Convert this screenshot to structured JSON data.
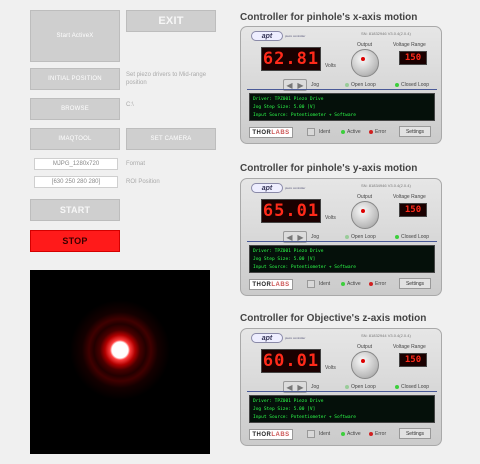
{
  "left": {
    "start_activex": "Start ActiveX",
    "exit": "EXIT",
    "initial_position": "INITIAL POSITION",
    "initial_position_note": "Set piezo drivers to Mid-range position",
    "browse": "BROWSE",
    "browse_path": "C:\\",
    "imaqtool": "IMAQTOOL",
    "set_camera": "SET CAMERA",
    "format_value": "MJPG_1280x720",
    "format_label": "Format",
    "roi_value": "[630 250 280 280]",
    "roi_label": "ROI Position",
    "start": "START",
    "stop": "STOP"
  },
  "controllers": [
    {
      "title": "Controller for pinhole's x-axis motion",
      "apt": "apt",
      "apt_sub": "piezo controller",
      "sn": "SN: 81832946  V3.0.4(2.0.4)",
      "display": "62.81",
      "volts": "Volts",
      "output_label": "Output",
      "vr_label": "Voltage Range",
      "vr": "150",
      "jog": "Jog",
      "open_loop": "Open Loop",
      "closed_loop": "Closed Loop",
      "status": [
        "Driver: TPZ001 Piezo Drive",
        "Jog Step Size: 5.00 [V]",
        "Input Source: Potentiometer + Software"
      ],
      "thorlabs": [
        "THOR",
        "LABS"
      ],
      "ident": "Ident",
      "active": "Active",
      "error": "Error",
      "settings": "Settings"
    },
    {
      "title": "Controller for pinhole's y-axis motion",
      "apt": "apt",
      "apt_sub": "piezo controller",
      "sn": "SN: 81834946  V3.0.4(2.0.4)",
      "display": "65.01",
      "volts": "Volts",
      "output_label": "Output",
      "vr_label": "Voltage Range",
      "vr": "150",
      "jog": "Jog",
      "open_loop": "Open Loop",
      "closed_loop": "Closed Loop",
      "status": [
        "Driver: TPZ001 Piezo Drive",
        "Jog Step Size: 5.00 [V]",
        "Input Source: Potentiometer + Software"
      ],
      "thorlabs": [
        "THOR",
        "LABS"
      ],
      "ident": "Ident",
      "active": "Active",
      "error": "Error",
      "settings": "Settings"
    },
    {
      "title": "Controller for Objective's z-axis motion",
      "apt": "apt",
      "apt_sub": "piezo controller",
      "sn": "SN: 81832944  V3.0.4(2.0.4)",
      "display": "60.01",
      "volts": "Volts",
      "output_label": "Output",
      "vr_label": "Voltage Range",
      "vr": "150",
      "jog": "Jog",
      "open_loop": "Open Loop",
      "closed_loop": "Closed Loop",
      "status": [
        "Driver: TPZ001 Piezo Drive",
        "Jog Step Size: 5.00 [V]",
        "Input Source: Potentiometer + Software"
      ],
      "thorlabs": [
        "THOR",
        "LABS"
      ],
      "ident": "Ident",
      "active": "Active",
      "error": "Error",
      "settings": "Settings"
    }
  ],
  "colors": {
    "stop": "#ff1a1a",
    "led_red": "#ff2a1a",
    "status_green": "#2cff4a",
    "active_green": "#3ccf3c",
    "error_red": "#d02020",
    "accent_blue": "#4a5a98"
  },
  "icons": {
    "jog_left": "◀",
    "jog_right": "▶"
  }
}
